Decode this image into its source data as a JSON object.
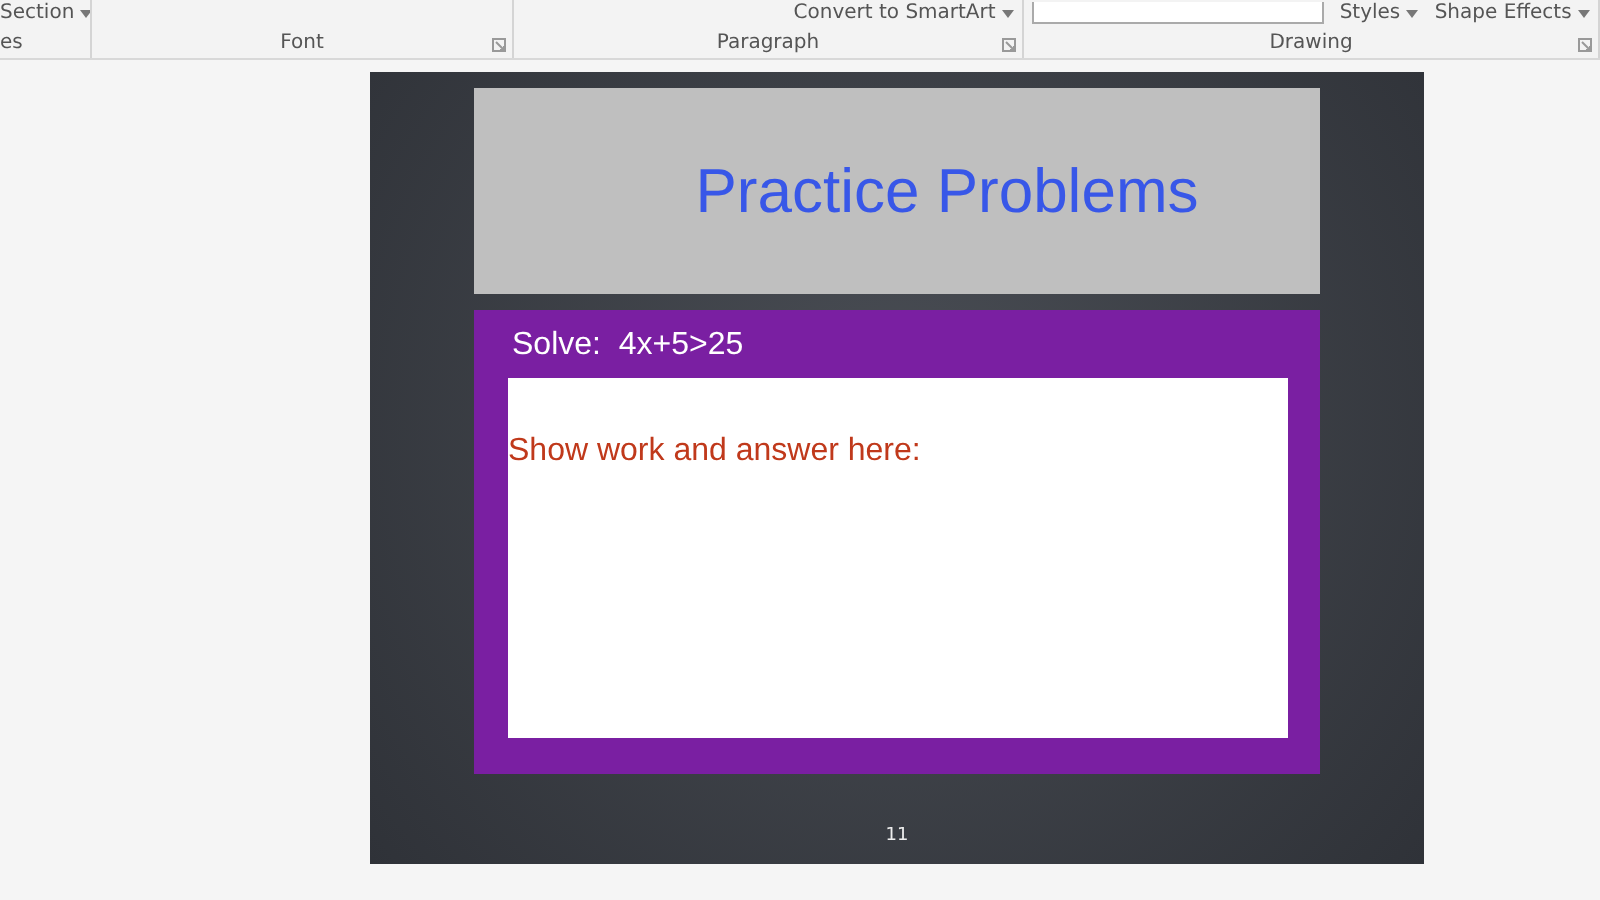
{
  "ribbon": {
    "groups": [
      {
        "label": "es",
        "launcher": false,
        "items": [
          {
            "kind": "dropdown",
            "text": "Section"
          }
        ]
      },
      {
        "label": "Font",
        "launcher": true
      },
      {
        "label": "Paragraph",
        "launcher": true,
        "items": [
          {
            "kind": "dropdown",
            "text": "Convert to SmartArt"
          }
        ]
      },
      {
        "label": "Drawing",
        "launcher": true,
        "items": [
          {
            "kind": "gallery"
          },
          {
            "kind": "dropdown",
            "text": "Styles"
          },
          {
            "kind": "dropdown",
            "text": "Shape Effects"
          }
        ]
      }
    ]
  },
  "slide": {
    "title": "Practice Problems",
    "prompt": "Solve:  4x+5>25",
    "answer_label": "Show work and answer here:",
    "page_number": "11"
  }
}
